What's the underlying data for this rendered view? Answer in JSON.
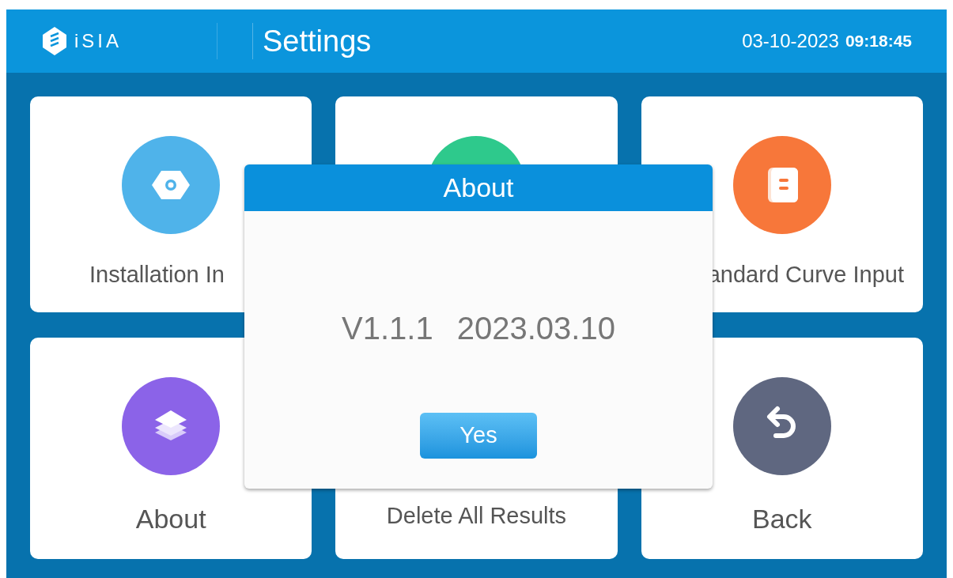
{
  "header": {
    "logo_text": "iSIA",
    "title": "Settings",
    "date": "03-10-2023",
    "time": "09:18:45"
  },
  "tiles": [
    {
      "label": "Installation In",
      "color": "#4fb3ea"
    },
    {
      "color": "#2ec98c"
    },
    {
      "label": "andard Curve Input",
      "color": "#f7773a"
    },
    {
      "label": "About",
      "color": "#8b63e8"
    },
    {
      "label": "Delete All Results"
    },
    {
      "label": "Back",
      "color": "#5f6780"
    }
  ],
  "dialog": {
    "title": "About",
    "version": "V1.1.1",
    "build_date": "2023.03.10",
    "button": "Yes"
  }
}
